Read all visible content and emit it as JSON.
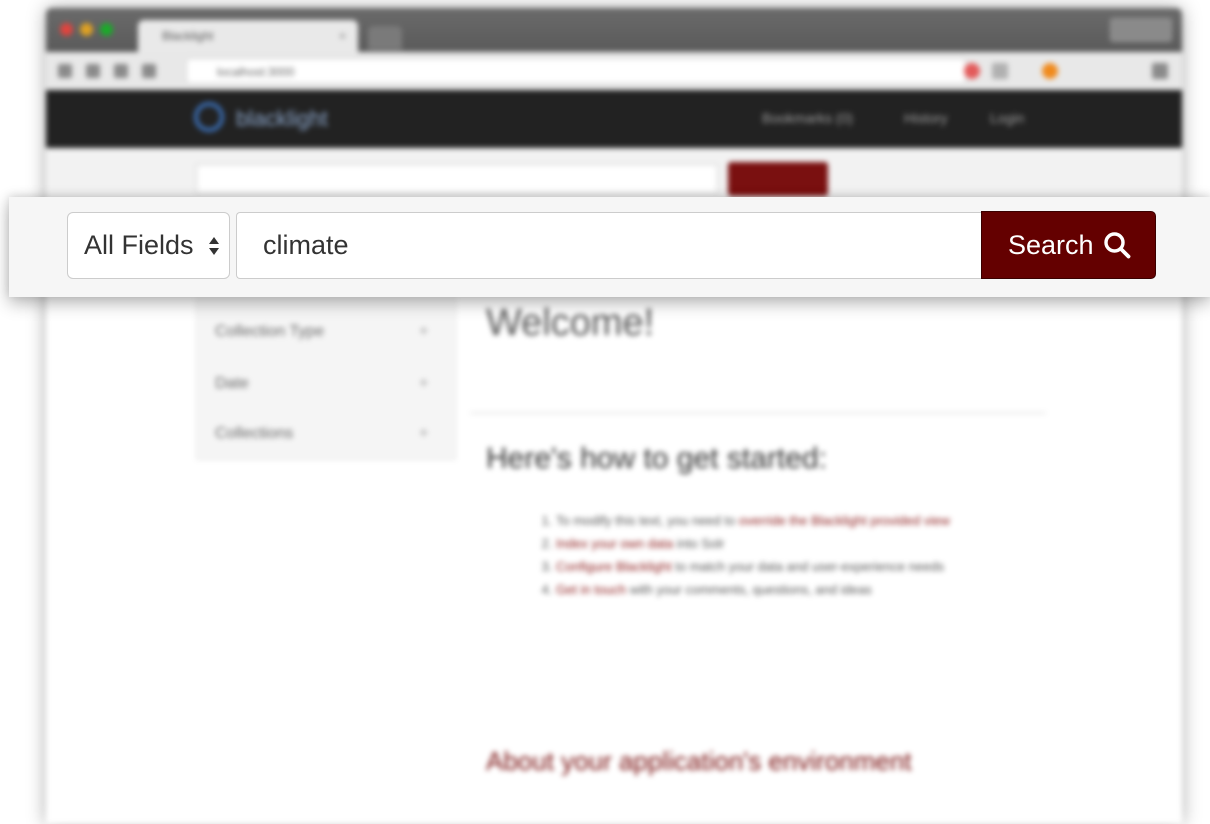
{
  "browser": {
    "tab_title": "Blacklight",
    "tab_close": "×",
    "address": "localhost:3000"
  },
  "navbar": {
    "brand": "blacklight",
    "links": [
      "Bookmarks (0)",
      "History",
      "Login"
    ]
  },
  "search": {
    "field_select": "All Fields",
    "query": "climate",
    "button_label": "Search"
  },
  "facets": [
    {
      "label": "Collection Type",
      "toggle": "+"
    },
    {
      "label": "Date",
      "toggle": "+"
    },
    {
      "label": "Collections",
      "toggle": "+"
    }
  ],
  "main": {
    "welcome": "Welcome!",
    "howto": "Here's how to get started:",
    "steps": [
      {
        "link": "override the Blacklight provided view",
        "text": "To modify this text, you need to"
      },
      {
        "link": "Index your own data",
        "text": "into Solr"
      },
      {
        "link": "Configure Blacklight",
        "text": "to match your data and user-experience needs"
      },
      {
        "link": "Get in touch",
        "text": "with your comments, questions, and ideas"
      }
    ],
    "about": "About your application's environment"
  },
  "colors": {
    "navbar": "#222222",
    "search_button": "#640000",
    "link": "#8b1a1a"
  }
}
